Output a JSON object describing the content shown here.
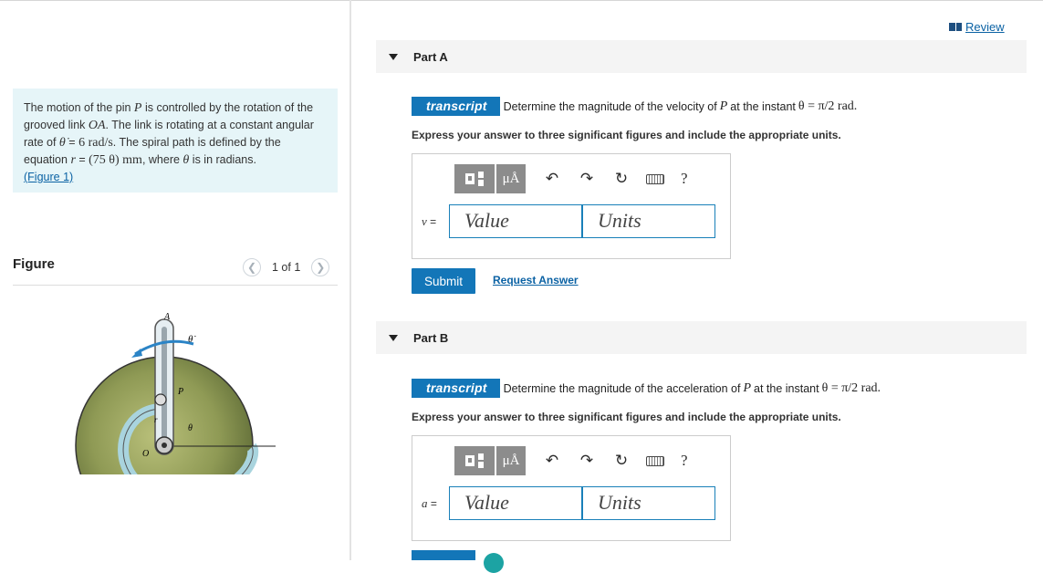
{
  "review": {
    "label": "Review",
    "icon": "book-icon",
    "color": "#1e4f80"
  },
  "problem": {
    "t1": "The motion of the pin ",
    "P": "P",
    "t2": " is controlled by the rotation of the grooved link ",
    "OA": "OA",
    "t3": ". The link is rotating at a constant angular rate of ",
    "thetadot": "θ̇",
    "t4": " = ",
    "rate": "6 rad/s",
    "t5": ". The spiral path is defined by the equation ",
    "r": "r",
    "t6": " = ",
    "eq": "(75 θ) mm",
    "t7": ", where ",
    "theta": "θ",
    "t8": " is in radians.",
    "figlink": "(Figure 1)"
  },
  "figure": {
    "title": "Figure",
    "pager": "1 of 1",
    "prev_icon": "chevron-left-icon",
    "next_icon": "chevron-right-icon",
    "labels": {
      "A": "A",
      "thetadot": "θ̇",
      "P": "P",
      "r": "r",
      "theta": "θ",
      "O": "O"
    }
  },
  "partA": {
    "header": "Part A",
    "badge": "transcript",
    "q1": "Determine the magnitude of the velocity of ",
    "P": "P",
    "q2": " at the instant ",
    "cond": "θ = π/2 rad.",
    "instructions": "Express your answer to three significant figures and include the appropriate units.",
    "var": "v",
    "eq": " =",
    "value_placeholder": "Value",
    "units_placeholder": "Units",
    "submit": "Submit",
    "request": "Request Answer",
    "mu": "μÅ",
    "help": "?"
  },
  "partB": {
    "header": "Part B",
    "badge": "transcript",
    "q1": "Determine the magnitude of the acceleration of ",
    "P": "P",
    "q2": " at the instant ",
    "cond": "θ = π/2 rad.",
    "instructions": "Express your answer to three significant figures and include the appropriate units.",
    "var": "a",
    "eq": " =",
    "value_placeholder": "Value",
    "units_placeholder": "Units",
    "mu": "μÅ",
    "help": "?"
  },
  "colors": {
    "accent": "#1376b8",
    "problem_bg": "#e6f5f8",
    "link": "#0b62a4"
  }
}
